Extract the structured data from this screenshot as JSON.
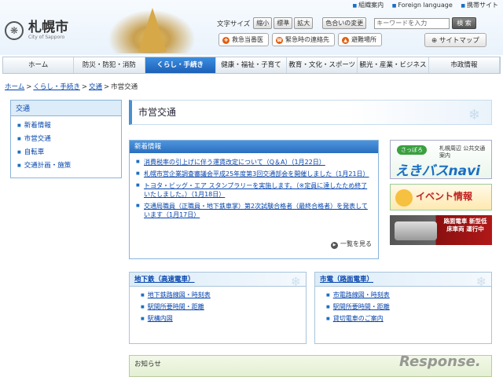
{
  "topbar": {
    "links": [
      "組織案内",
      "Foreign language",
      "携帯サイト"
    ]
  },
  "logo": {
    "name": "札幌市",
    "sub": "City of Sapporo"
  },
  "tools": {
    "font_size_label": "文字サイズ",
    "font_sizes": [
      "縮小",
      "標準",
      "拡大"
    ],
    "color_change": "色合いの変更",
    "search_placeholder": "キーワードを入力",
    "search_button": "検 索"
  },
  "emergency": [
    "救急当番医",
    "緊急時の連絡先",
    "避難場所"
  ],
  "sitemap": "サイトマップ",
  "nav": [
    "ホーム",
    "防災・防犯・消防",
    "くらし・手続き",
    "健康・福祉・子育て",
    "教育・文化・スポーツ",
    "観光・産業・ビジネス",
    "市政情報"
  ],
  "breadcrumb": {
    "items": [
      "ホーム",
      "くらし・手続き",
      "交通"
    ],
    "current": "市営交通",
    "separator": ">"
  },
  "sidebar": {
    "heading": "交通",
    "items": [
      "新着情報",
      "市営交通",
      "自転車",
      "交通計画・施策"
    ]
  },
  "page_title": "市営交通",
  "news": {
    "heading": "新着情報",
    "items": [
      "消費税率の引上げに伴う運賃改定について（Q＆A）（1月22日）",
      "札幌市営企業調査審議会平成25年度第3回交通部会を開催しました（1月21日）",
      "トヨタ・ビッグ・エア スタンプラリーを実施します。（※定員に達したため終了いたしました。）（1月18日）",
      "交通局職員（正職員・地下鉄車掌）第2次試験合格者（最終合格者）を発表しています（1月17日）"
    ],
    "more": "一覧を見る"
  },
  "banners": {
    "ekibus_badge": "さっぽろ",
    "ekibus_sub": "札幌周辺 公共交通案内",
    "ekibus_main": "えきバスnavi",
    "event": "イベント情報",
    "tram": "路面電車 新型低床車両 運行中"
  },
  "subway": {
    "heading": "地下鉄（高速電車）",
    "items": [
      "地下鉄路線図・時刻表",
      "駅間所要時間・距離",
      "駅構内図"
    ]
  },
  "tram": {
    "heading": "市電（路面電車）",
    "items": [
      "市電路線図・時刻表",
      "駅間所要時間・距離",
      "貸切電車のご案内"
    ]
  },
  "notice": {
    "heading": "お知らせ"
  },
  "watermark": "Response."
}
